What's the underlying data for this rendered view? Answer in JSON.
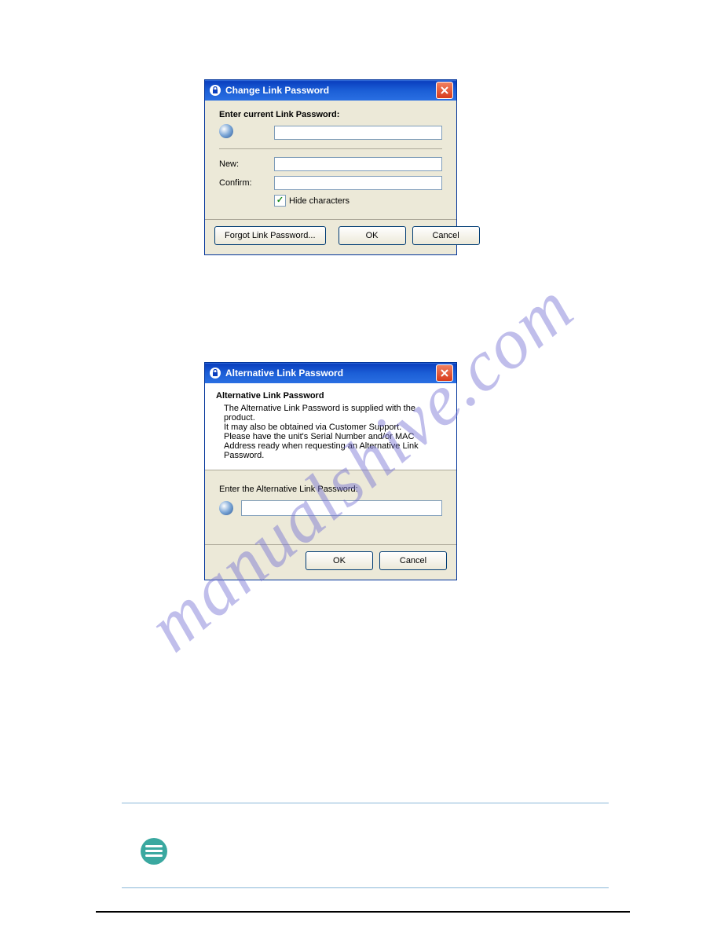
{
  "dialog1": {
    "title": "Change Link Password",
    "prompt": "Enter current Link Password:",
    "labels": {
      "new": "New:",
      "confirm": "Confirm:"
    },
    "hide_chars": {
      "label": "Hide characters",
      "checked": true
    },
    "buttons": {
      "forgot": "Forgot Link Password...",
      "ok": "OK",
      "cancel": "Cancel"
    }
  },
  "dialog2": {
    "title": "Alternative Link Password",
    "heading": "Alternative Link Password",
    "info_line1": "The Alternative Link Password is supplied with the product.",
    "info_line2": "It may also be obtained via Customer Support.",
    "info_line3": "Please have the unit's Serial Number and/or MAC Address ready when requesting an Alternative Link Password.",
    "prompt": "Enter the Alternative Link Password:",
    "buttons": {
      "ok": "OK",
      "cancel": "Cancel"
    }
  },
  "watermark": "manualshive.com"
}
